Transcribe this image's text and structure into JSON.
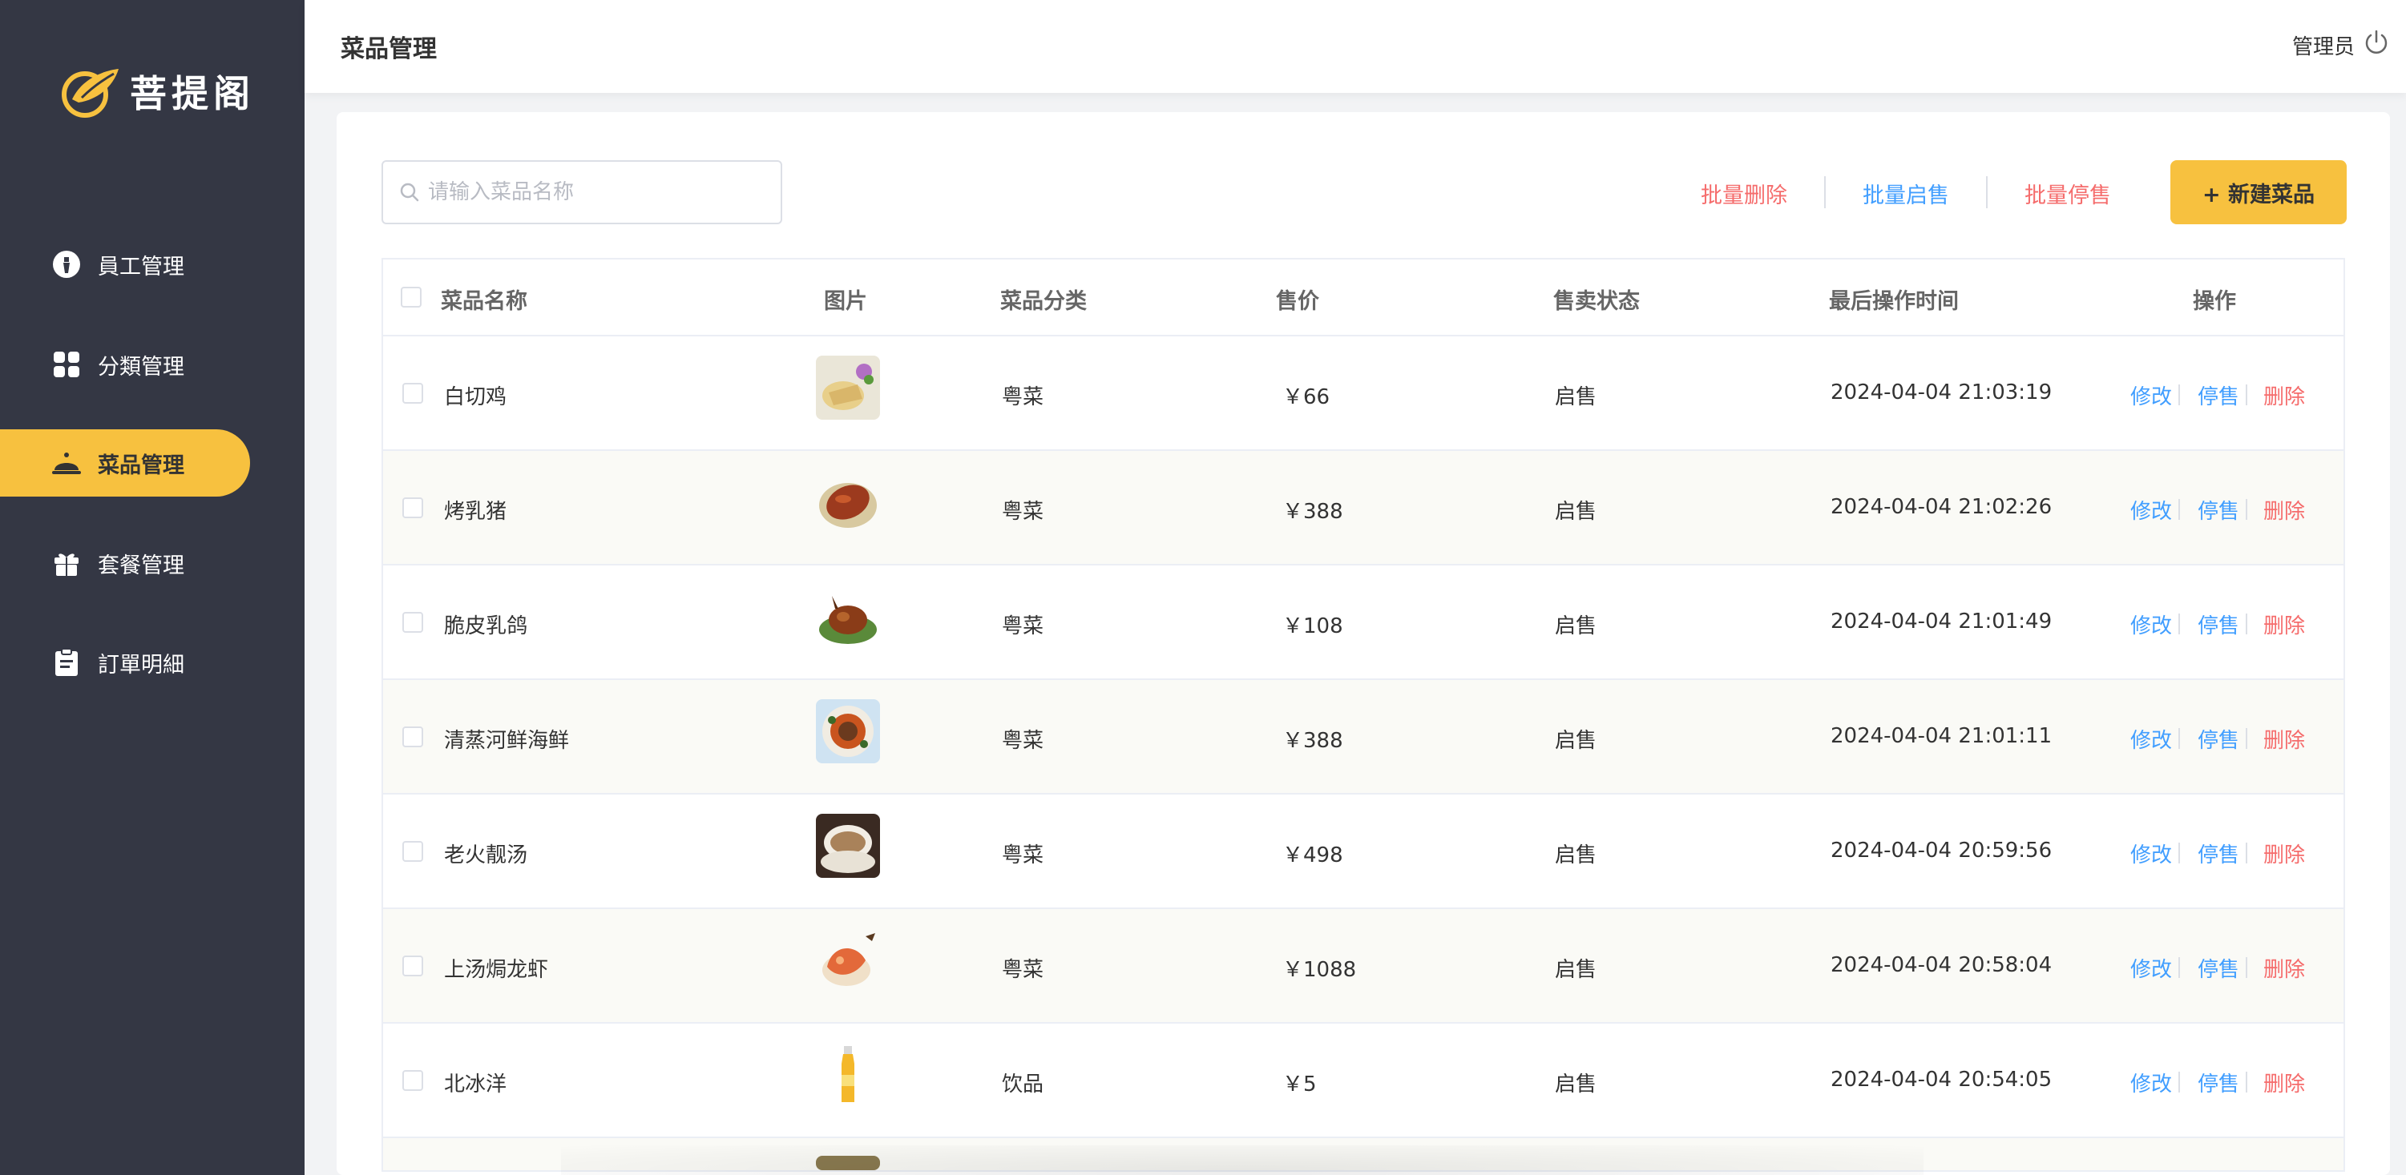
{
  "brand": {
    "name": "菩提阁"
  },
  "sidebar": {
    "items": [
      {
        "label": "員工管理",
        "icon": "employee-icon",
        "active": false
      },
      {
        "label": "分類管理",
        "icon": "category-grid-icon",
        "active": false
      },
      {
        "label": "菜品管理",
        "icon": "cloche-icon",
        "active": true
      },
      {
        "label": "套餐管理",
        "icon": "gift-icon",
        "active": false
      },
      {
        "label": "訂單明細",
        "icon": "clipboard-icon",
        "active": false
      }
    ]
  },
  "header": {
    "title": "菜品管理",
    "user": "管理员",
    "logout_icon": "power-icon"
  },
  "toolbar": {
    "search_placeholder": "请输入菜品名称",
    "batch_delete": "批量删除",
    "batch_enable": "批量启售",
    "batch_disable": "批量停售",
    "new_dish": "+ 新建菜品"
  },
  "table": {
    "columns": [
      "菜品名称",
      "图片",
      "菜品分类",
      "售价",
      "售卖状态",
      "最后操作时间",
      "操作"
    ],
    "rows": [
      {
        "name": "白切鸡",
        "category": "粤菜",
        "price": "￥66",
        "status": "启售",
        "time": "2024-04-04 21:03:19"
      },
      {
        "name": "烤乳猪",
        "category": "粤菜",
        "price": "￥388",
        "status": "启售",
        "time": "2024-04-04 21:02:26"
      },
      {
        "name": "脆皮乳鸽",
        "category": "粤菜",
        "price": "￥108",
        "status": "启售",
        "time": "2024-04-04 21:01:49"
      },
      {
        "name": "清蒸河鲜海鲜",
        "category": "粤菜",
        "price": "￥388",
        "status": "启售",
        "time": "2024-04-04 21:01:11"
      },
      {
        "name": "老火靓汤",
        "category": "粤菜",
        "price": "￥498",
        "status": "启售",
        "time": "2024-04-04 20:59:56"
      },
      {
        "name": "上汤焗龙虾",
        "category": "粤菜",
        "price": "￥1088",
        "status": "启售",
        "time": "2024-04-04 20:58:04"
      },
      {
        "name": "北冰洋",
        "category": "饮品",
        "price": "￥5",
        "status": "启售",
        "time": "2024-04-04 20:54:05"
      }
    ],
    "actions": {
      "edit": "修改",
      "disable": "停售",
      "delete": "删除"
    }
  },
  "colors": {
    "sidebar_bg": "#343744",
    "accent": "#f7c13f",
    "link_blue": "#419eff",
    "link_red": "#f56c6c"
  }
}
